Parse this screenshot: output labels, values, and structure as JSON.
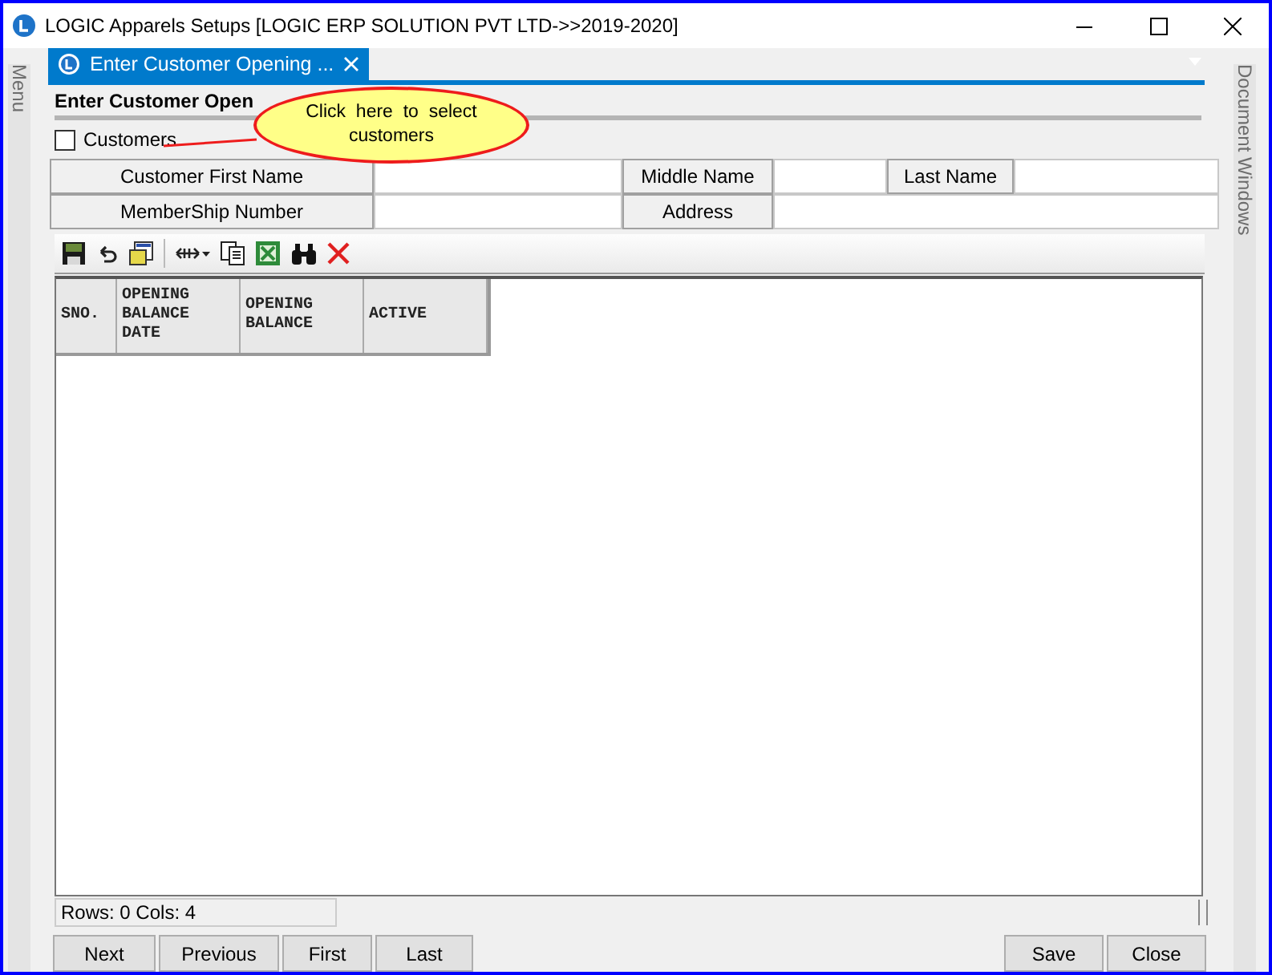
{
  "window": {
    "title": "LOGIC Apparels Setups  [LOGIC ERP SOLUTION PVT LTD->>2019-2020]"
  },
  "side_panels": {
    "left": "Menu",
    "right": "Document Windows"
  },
  "tabs": [
    {
      "label": "Enter Customer Opening ...",
      "selected": true
    }
  ],
  "heading": "Enter Customer Open",
  "customers_checkbox": {
    "label": "Customers",
    "checked": false
  },
  "callout": "Click  here  to  select customers",
  "fields": [
    {
      "label": "Customer First Name"
    },
    {
      "label": "Middle Name"
    },
    {
      "label": "Last Name"
    },
    {
      "label": "MemberShip Number"
    },
    {
      "label": "Address"
    }
  ],
  "table": {
    "columns": [
      "SNO.",
      "OPENING BALANCE DATE",
      "OPENING BALANCE",
      "ACTIVE"
    ]
  },
  "status_bar": "Rows: 0  Cols: 4",
  "buttons_left": [
    "Next",
    "Previous",
    "First",
    "Last"
  ],
  "buttons_right": [
    "Save",
    "Close"
  ]
}
